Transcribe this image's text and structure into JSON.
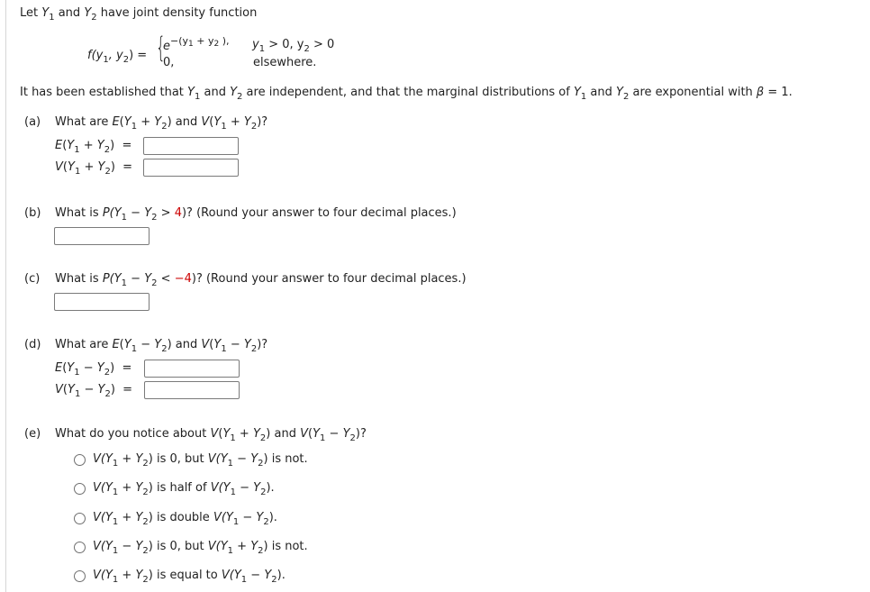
{
  "intro": {
    "text_let": "Let ",
    "y": "Y",
    "s1": "1",
    "s2": "2",
    "and": " and ",
    "rest": " have joint density function"
  },
  "formula": {
    "lhs": "f(y",
    "comma": ", y",
    "close_eq": ") = ",
    "e": "e",
    "exp_open": "−(y",
    "exp_plus": " + y",
    "exp_close": " ),",
    "cond1_a": "y",
    "cond1_b": " > 0, y",
    "cond1_c": " > 0",
    "case2_val": "0,",
    "case2_cond": "elsewhere."
  },
  "established": {
    "t1": "It has been established that ",
    "t2": " and ",
    "t3": " are independent, and that the marginal distributions of ",
    "t4": " and ",
    "t5": " are exponential with ",
    "beta": "β",
    "t6": " = 1."
  },
  "parts": {
    "a": {
      "label": "(a)",
      "q_pre": "What are ",
      "q_mid": " and ",
      "q_end": "?",
      "e_expr": "E(Y₁ + Y₂)",
      "v_expr": "V(Y₁ + Y₂)",
      "eq": "=",
      "answer_e": "",
      "answer_v": ""
    },
    "b": {
      "label": "(b)",
      "q_pre": "What is ",
      "p_open": "P(Y",
      "minus": " − Y",
      "gt": " > ",
      "value": "4",
      "q_end": ")? (Round your answer to four decimal places.)",
      "answer": ""
    },
    "c": {
      "label": "(c)",
      "q_pre": "What is ",
      "p_open": "P(Y",
      "minus": " − Y",
      "lt": " < ",
      "value": "−4",
      "q_end": ")? (Round your answer to four decimal places.)",
      "answer": ""
    },
    "d": {
      "label": "(d)",
      "q_pre": "What are ",
      "q_mid": " and ",
      "q_end": "?",
      "eq": "=",
      "answer_e": "",
      "answer_v": ""
    },
    "e": {
      "label": "(e)",
      "q_pre": "What do you notice about ",
      "q_mid": " and ",
      "q_end": "?",
      "options": [
        {
          "a": "V(Y",
          "a_op": " + Y",
          "mid": ") is 0, but ",
          "b": "V(Y",
          "b_op": " − Y",
          "end": ") is not."
        },
        {
          "a": "V(Y",
          "a_op": " + Y",
          "mid": ") is half of ",
          "b": "V(Y",
          "b_op": " − Y",
          "end": ")."
        },
        {
          "a": "V(Y",
          "a_op": " + Y",
          "mid": ") is double ",
          "b": "V(Y",
          "b_op": " − Y",
          "end": ")."
        },
        {
          "a": "V(Y",
          "a_op": " − Y",
          "mid": ") is 0, but ",
          "b": "V(Y",
          "b_op": " + Y",
          "end": ") is not."
        },
        {
          "a": "V(Y",
          "a_op": " + Y",
          "mid": ") is equal to ",
          "b": "V(Y",
          "b_op": " − Y",
          "end": ")."
        }
      ]
    }
  },
  "colors": {
    "text": "#222222",
    "highlight_red": "#cc0000",
    "input_border": "#7a7a7a"
  }
}
